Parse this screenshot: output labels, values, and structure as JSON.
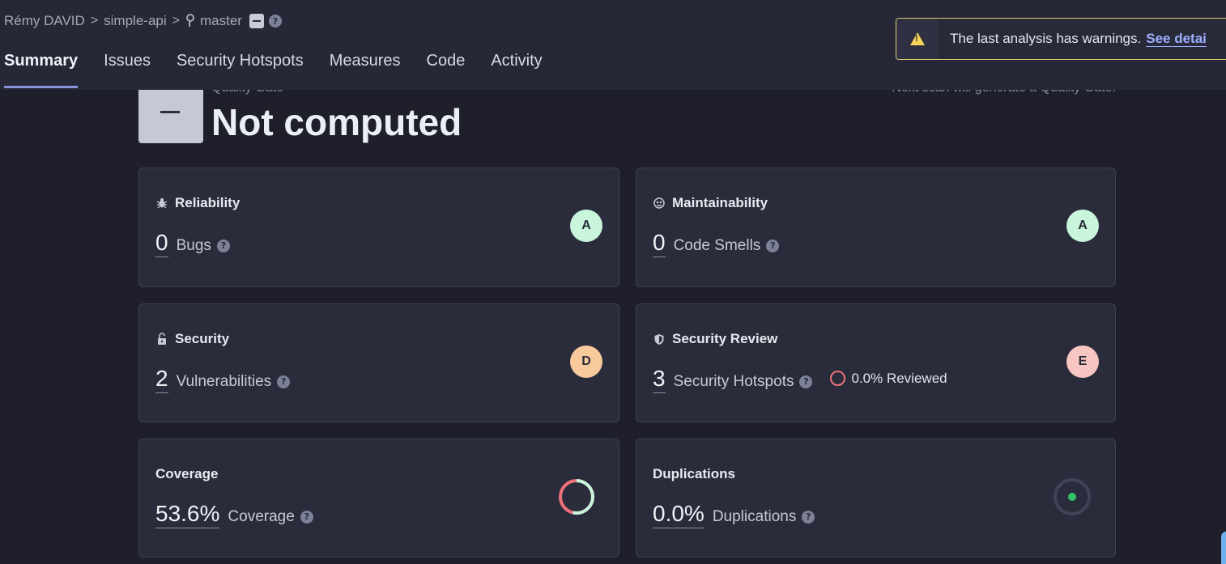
{
  "breadcrumb": {
    "owner": "Rémy DAVID",
    "project": "simple-api",
    "branch": "master"
  },
  "tabs": [
    {
      "label": "Summary",
      "active": true
    },
    {
      "label": "Issues"
    },
    {
      "label": "Security Hotspots"
    },
    {
      "label": "Measures"
    },
    {
      "label": "Code"
    },
    {
      "label": "Activity"
    }
  ],
  "warning": {
    "message": "The last analysis has warnings.",
    "link": "See detai"
  },
  "quality_gate": {
    "label": "Quality Gate",
    "status": "Not computed",
    "note": "Next scan will generate a Quality Gate."
  },
  "cards": {
    "reliability": {
      "title": "Reliability",
      "value": "0",
      "label": "Bugs",
      "rating": "A",
      "rating_color": "#c9f5dc"
    },
    "maintainability": {
      "title": "Maintainability",
      "value": "0",
      "label": "Code Smells",
      "rating": "A",
      "rating_color": "#c9f5dc"
    },
    "security": {
      "title": "Security",
      "value": "2",
      "label": "Vulnerabilities",
      "rating": "D",
      "rating_color": "#f7c99b"
    },
    "security_review": {
      "title": "Security Review",
      "value": "3",
      "label": "Security Hotspots",
      "reviewed": "0.0% Reviewed",
      "rating": "E",
      "rating_color": "#f8c6c2"
    },
    "coverage": {
      "title": "Coverage",
      "value": "53.6%",
      "label": "Coverage",
      "percent": 53.6
    },
    "duplications": {
      "title": "Duplications",
      "value": "0.0%",
      "label": "Duplications"
    }
  },
  "colors": {
    "accent": "#8a93d9",
    "warning_border": "#e0c872",
    "coverage_covered": "#c9f5dc",
    "coverage_uncovered": "#f0707a",
    "duplication_dot": "#33c26b"
  },
  "icons": [
    "branch-icon",
    "help-icon",
    "warning-icon",
    "bug-icon",
    "maintainability-icon",
    "lock-icon",
    "shield-icon"
  ]
}
